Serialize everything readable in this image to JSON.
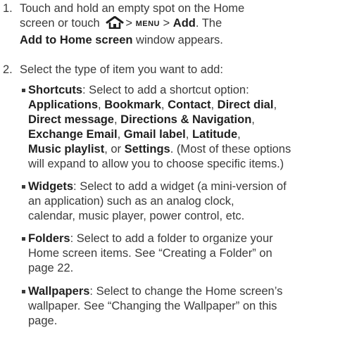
{
  "step1": {
    "number": "1.",
    "text_a": "Touch and hold an empty spot on the Home",
    "text_b": "screen or touch",
    "gt1": ">",
    "menu_key": "MENU",
    "gt2": ">",
    "add_label": "Add",
    "text_c": ". The",
    "window_name": "Add to Home screen",
    "text_d": " window appears."
  },
  "step2": {
    "number": "2.",
    "text": "Select the type of item you want to add:"
  },
  "shortcuts": {
    "label": "Shortcuts",
    "text_a": ": Select to add a shortcut option:",
    "options": [
      "Applications",
      "Bookmark",
      "Contact",
      "Direct dial",
      "Direct message",
      "Directions & Navigation",
      "Exchange Email",
      "Gmail label",
      "Latitude",
      "Music playlist",
      "Settings"
    ],
    "sep": ", ",
    "or": ", or ",
    "end": ". (Most of these options",
    "line5": "will expand to allow you to choose specific items.)"
  },
  "widgets": {
    "label": "Widgets",
    "text_a": ": Select to add a widget (a mini-version of",
    "text_b": "an application) such as an analog clock,",
    "text_c": "calendar, music player, power control, etc."
  },
  "folders": {
    "label": "Folders",
    "text_a": ": Select to add a folder to organize your",
    "text_b": "Home screen items. See “Creating a Folder” on",
    "text_c": "page 22."
  },
  "wallpapers": {
    "label": "Wallpapers",
    "text_a": ": Select to change the Home screen’s",
    "text_b": "wallpaper. See “Changing the Wallpaper” on this",
    "text_c": "page."
  },
  "icons": {
    "home": "home-icon",
    "bullet": "square-bullet-icon"
  }
}
